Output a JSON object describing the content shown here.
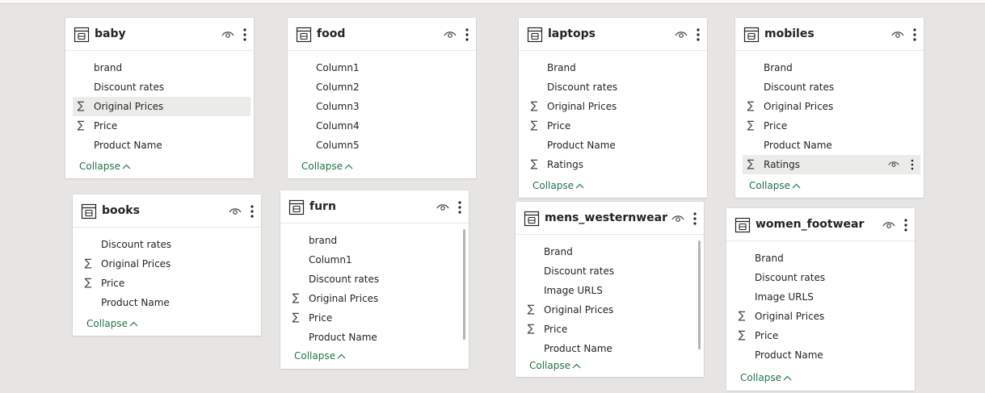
{
  "tables": {
    "baby": {
      "title": "baby",
      "fields": [
        "brand",
        "Discount rates",
        "Original Prices",
        "Price",
        "Product Name"
      ],
      "collapse": "Collapse"
    },
    "food": {
      "title": "food",
      "fields": [
        "Column1",
        "Column2",
        "Column3",
        "Column4",
        "Column5"
      ],
      "collapse": "Collapse"
    },
    "laptops": {
      "title": "laptops",
      "fields": [
        "Brand",
        "Discount rates",
        "Original Prices",
        "Price",
        "Product Name",
        "Ratings"
      ],
      "collapse": "Collapse"
    },
    "mobiles": {
      "title": "mobiles",
      "fields": [
        "Brand",
        "Discount rates",
        "Original Prices",
        "Price",
        "Product Name",
        "Ratings"
      ],
      "collapse": "Collapse"
    },
    "books": {
      "title": "books",
      "fields": [
        "Discount rates",
        "Original Prices",
        "Price",
        "Product Name"
      ],
      "collapse": "Collapse"
    },
    "furn": {
      "title": "furn",
      "fields": [
        "brand",
        "Column1",
        "Discount rates",
        "Original Prices",
        "Price",
        "Product Name"
      ],
      "collapse": "Collapse"
    },
    "mens_westernwear": {
      "title": "mens_westernwear",
      "fields": [
        "Brand",
        "Discount rates",
        "Image URLS",
        "Original Prices",
        "Price",
        "Product Name"
      ],
      "collapse": "Collapse"
    },
    "women_footwear": {
      "title": "women_footwear",
      "fields": [
        "Brand",
        "Discount rates",
        "Image URLS",
        "Original Prices",
        "Price",
        "Product Name"
      ],
      "collapse": "Collapse"
    }
  },
  "icons": {
    "table": "table-icon",
    "visibility": "eye-icon",
    "more": "more-options-icon",
    "sum": "sigma-icon",
    "collapse": "chevron-up-icon"
  },
  "colors": {
    "canvas": "#e6e5e3",
    "card": "#ffffff",
    "collapse_link": "#217346",
    "highlight_row": "#ebebea"
  }
}
